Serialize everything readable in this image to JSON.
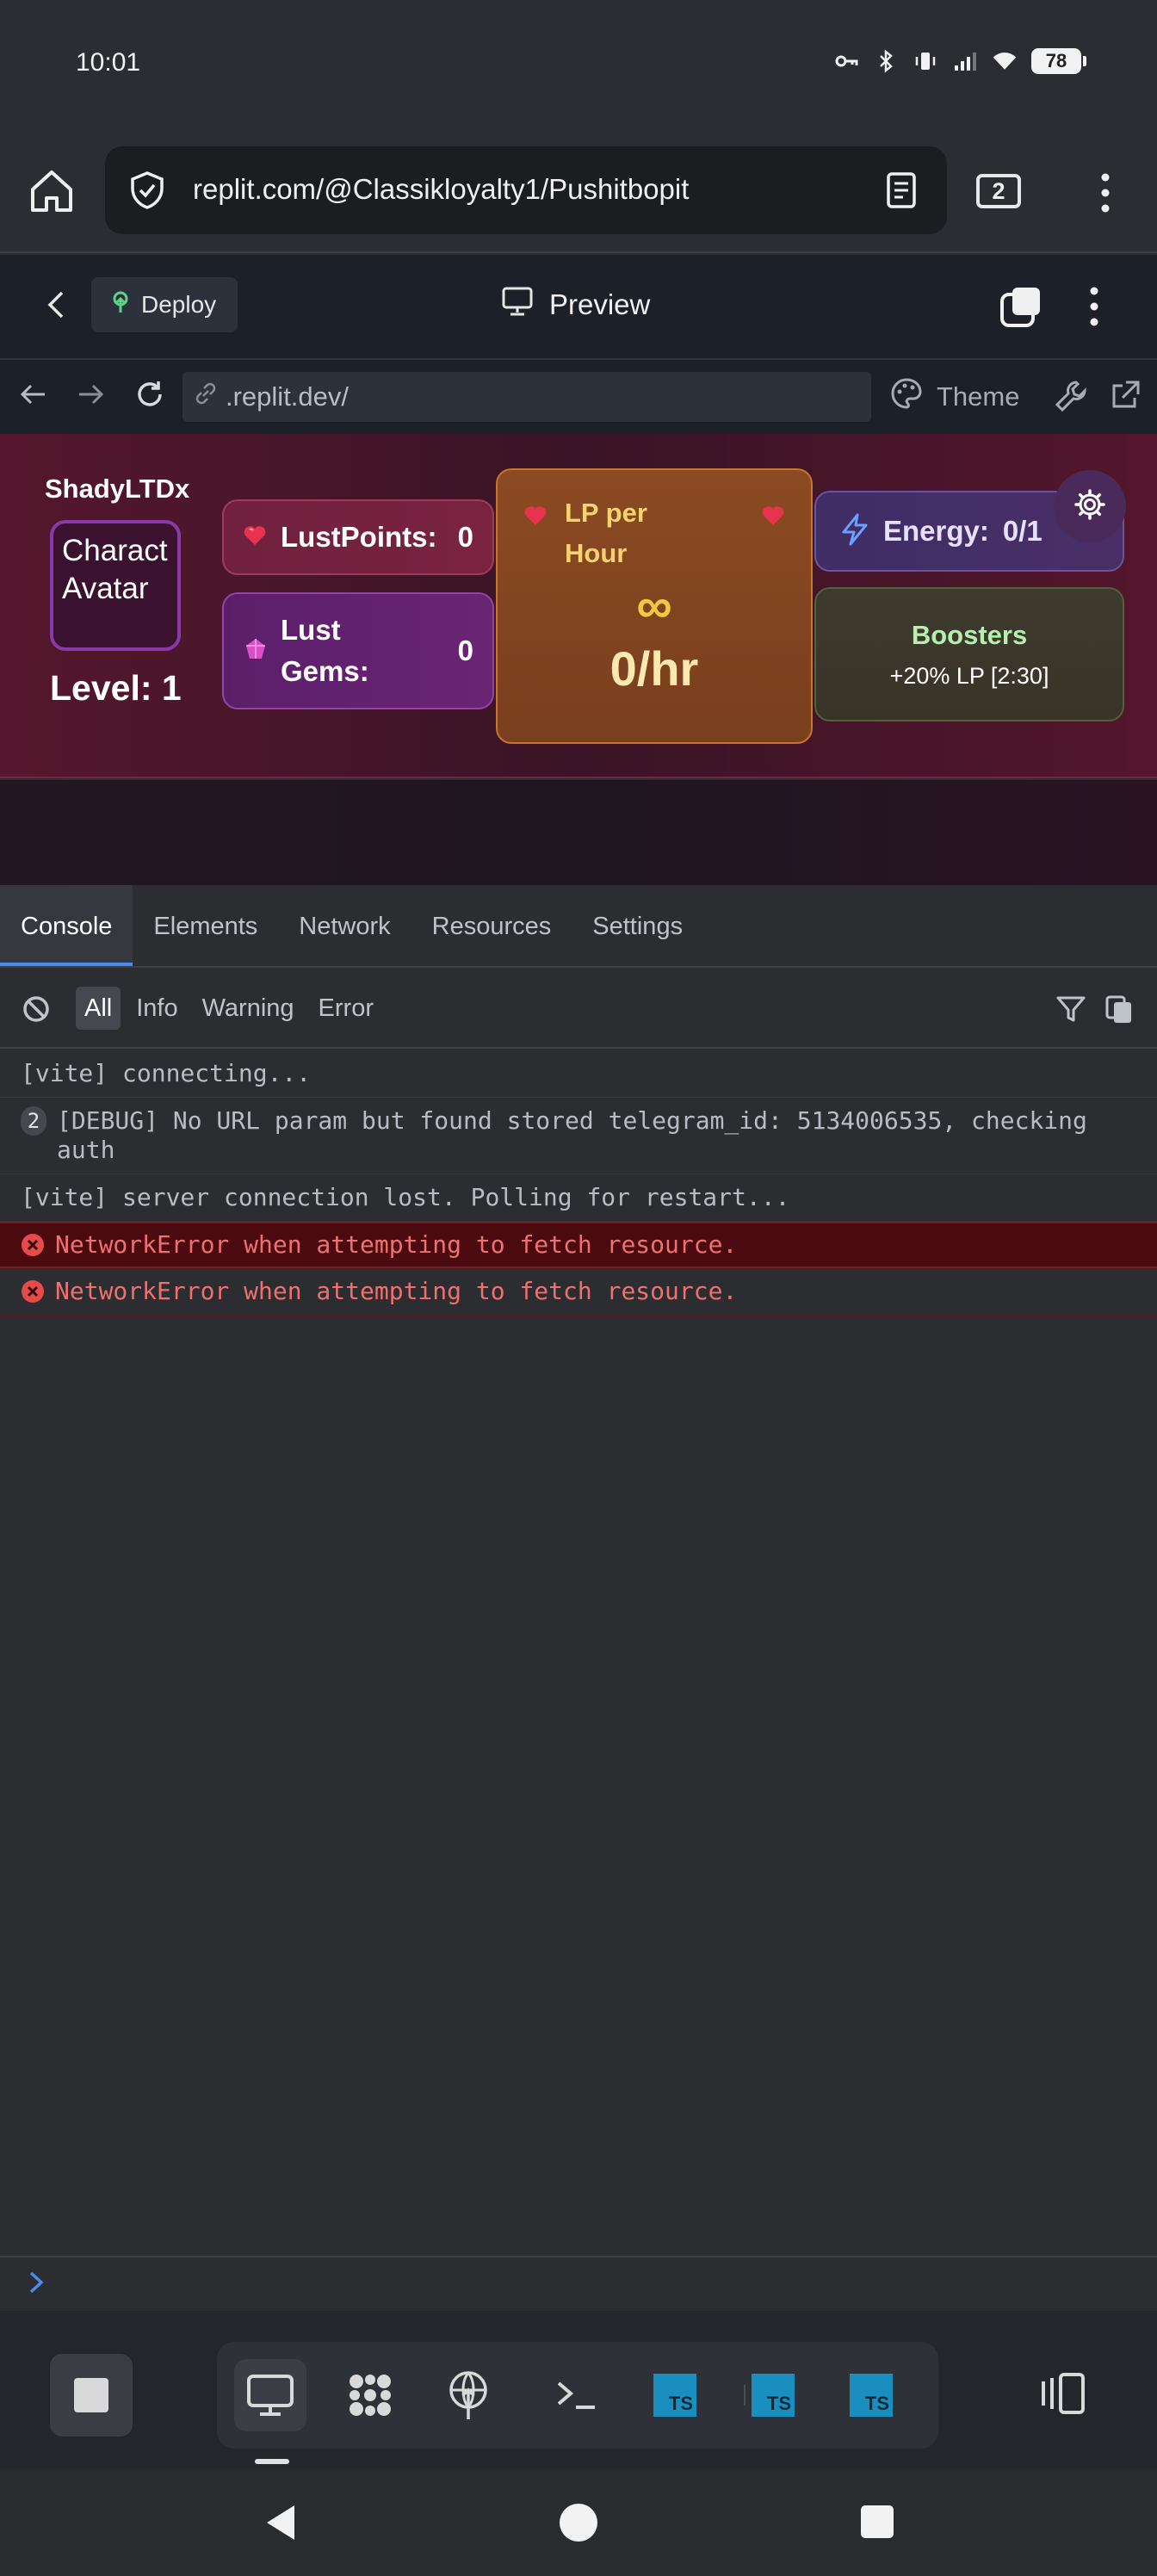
{
  "status_bar": {
    "time": "10:01",
    "battery": "78"
  },
  "browser": {
    "url": "replit.com/@Classikloyalty1/Pushitbopit",
    "tab_count": "2"
  },
  "replit_header": {
    "deploy_label": "Deploy",
    "preview_label": "Preview"
  },
  "address": {
    "url": ".replit.dev/",
    "theme_label": "Theme"
  },
  "game": {
    "username": "ShadyLTDx",
    "avatar_text": "Character Avatar",
    "avatar_line1": "Charact",
    "avatar_line2": "Avatar",
    "level": "Level: 1",
    "lust_points_label": "LustPoints:",
    "lust_points_value": "0",
    "lust_gems_label_line1": "Lust",
    "lust_gems_label_line2": "Gems:",
    "lust_gems_value": "0",
    "lp_per_hour_line1": "LP per",
    "lp_per_hour_line2": "Hour",
    "lp_infinity": "∞",
    "lp_rate": "0/hr",
    "energy_label": "Energy:",
    "energy_value": "0/1",
    "boosters_title": "Boosters",
    "boosters_sub": "+20% LP [2:30]"
  },
  "devtools": {
    "tabs": [
      "Console",
      "Elements",
      "Network",
      "Resources",
      "Settings"
    ],
    "filters": [
      "All",
      "Info",
      "Warning",
      "Error"
    ],
    "logs": [
      {
        "text": "[vite] connecting..."
      },
      {
        "count": "2",
        "text": "[DEBUG] No URL param but found stored telegram_id: 5134006535, checking auth"
      },
      {
        "text": "[vite] server connection lost. Polling for restart..."
      },
      {
        "text": "NetworkError when attempting to fetch resource."
      },
      {
        "text": "NetworkError when attempting to fetch resource."
      }
    ]
  },
  "dock": {
    "ts_label": "TS"
  },
  "colors": {
    "accent": "#4a8cf0",
    "error": "#f07070",
    "lp_gold": "#f6c542"
  }
}
